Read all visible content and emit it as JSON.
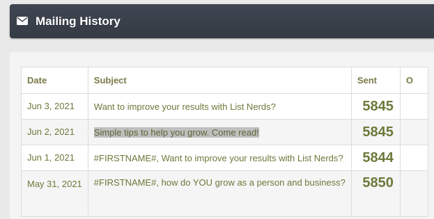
{
  "header": {
    "title": "Mailing History",
    "icon": "envelope-icon"
  },
  "table": {
    "columns": [
      "Date",
      "Subject",
      "Sent",
      "O"
    ],
    "rows": [
      {
        "date": "Jun 3, 2021",
        "subject": "Want to improve your results with List Nerds?",
        "sent": "5845"
      },
      {
        "date": "Jun 2, 2021",
        "subject": "Simple tips to help you grow. Come read!",
        "sent": "5845"
      },
      {
        "date": "Jun 1, 2021",
        "subject": "#FIRSTNAME#, Want to improve your results with List Nerds?",
        "sent": "5844"
      },
      {
        "date": "May 31, 2021",
        "subject": "#FIRSTNAME#, how do YOU grow as a person and business?",
        "sent": "5850"
      }
    ]
  },
  "colors": {
    "header_bg": "#3f4651",
    "text_olive": "#6b7a3a",
    "highlight": "#bfbfbf"
  }
}
